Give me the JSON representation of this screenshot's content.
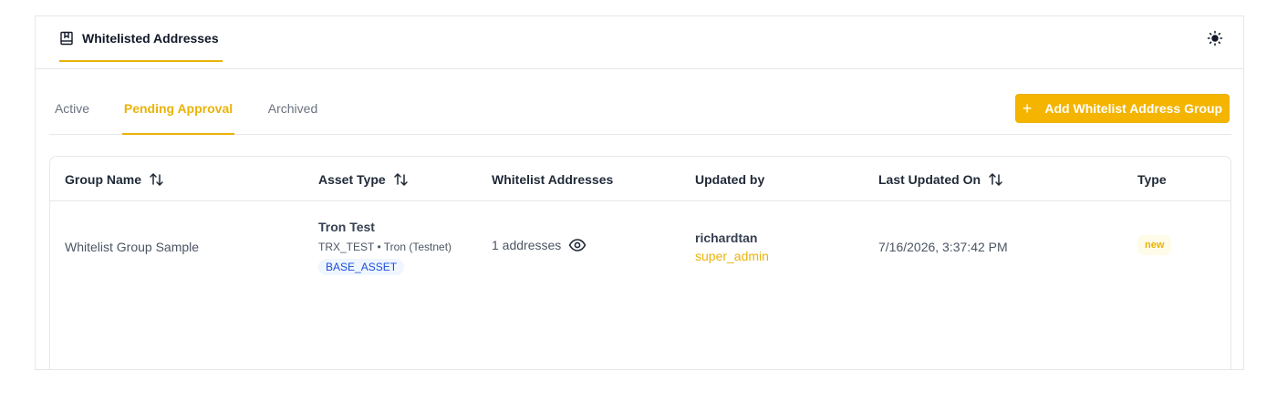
{
  "header": {
    "page_tab_label": "Whitelisted Addresses",
    "page_icon": "book-icon",
    "theme_icon": "sun-icon"
  },
  "tabs": [
    {
      "label": "Active",
      "active": false
    },
    {
      "label": "Pending Approval",
      "active": true
    },
    {
      "label": "Archived",
      "active": false
    }
  ],
  "actions": {
    "add_button_icon": "+",
    "add_button_label": "Add Whitelist Address Group"
  },
  "table": {
    "columns": [
      {
        "label": "Group Name",
        "sortable": true
      },
      {
        "label": "Asset Type",
        "sortable": true
      },
      {
        "label": "Whitelist Addresses",
        "sortable": false
      },
      {
        "label": "Updated by",
        "sortable": false
      },
      {
        "label": "Last Updated On",
        "sortable": true
      },
      {
        "label": "Type",
        "sortable": false
      }
    ],
    "rows": [
      {
        "group_name": "Whitelist Group Sample",
        "asset_name": "Tron Test",
        "asset_sub": "TRX_TEST • Tron (Testnet)",
        "asset_badge": "BASE_ASSET",
        "addresses": "1 addresses",
        "updated_by_name": "richardtan",
        "updated_by_role": "super_admin",
        "last_updated": "7/16/2026, 3:37:42 PM",
        "type": "new"
      }
    ]
  },
  "colors": {
    "accent": "#eab308",
    "button_bg": "#f4b400",
    "badge_blue_bg": "#eff6ff",
    "badge_blue_text": "#1d4ed8",
    "border": "#e5e7eb"
  }
}
